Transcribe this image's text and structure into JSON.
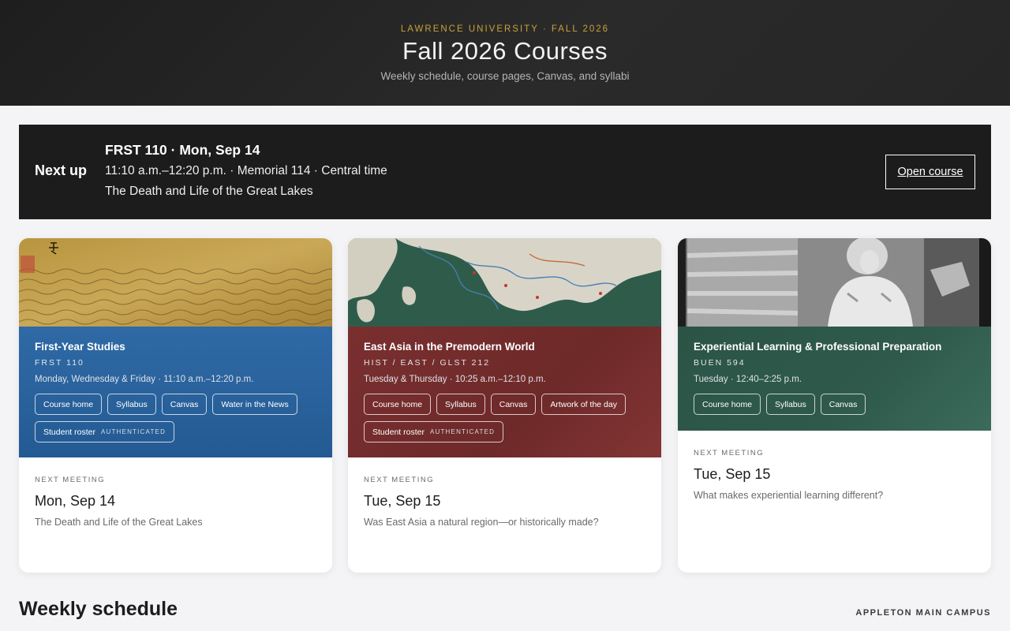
{
  "header": {
    "eyebrow": "LAWRENCE UNIVERSITY · FALL 2026",
    "title": "Fall 2026 Courses",
    "subtitle": "Weekly schedule, course pages, Canvas, and syllabi"
  },
  "next_up": {
    "label": "Next up",
    "line1": "FRST 110 · Mon, Sep 14",
    "line2": "11:10 a.m.–12:20 p.m. · Memorial 114 · Central time",
    "line3": "The Death and Life of the Great Lakes",
    "button": "Open course"
  },
  "cards": [
    {
      "name": "First-Year Studies",
      "code": "FRST 110",
      "time": "Monday, Wednesday & Friday · 11:10 a.m.–12:20 p.m.",
      "image_icon": "waves-scroll-image",
      "links": [
        "Course home",
        "Syllabus",
        "Canvas",
        "Water in the News"
      ],
      "roster": "Student roster",
      "roster_badge": "AUTHENTICATED",
      "meeting_label": "NEXT MEETING",
      "meeting_date": "Mon, Sep 14",
      "meeting_topic": "The Death and Life of the Great Lakes"
    },
    {
      "name": "East Asia in the Premodern World",
      "code": "HIST / EAST / GLST 212",
      "time": "Tuesday & Thursday · 10:25 a.m.–12:10 p.m.",
      "image_icon": "historic-map-image",
      "links": [
        "Course home",
        "Syllabus",
        "Canvas",
        "Artwork of the day"
      ],
      "roster": "Student roster",
      "roster_badge": "AUTHENTICATED",
      "meeting_label": "NEXT MEETING",
      "meeting_date": "Tue, Sep 15",
      "meeting_topic": "Was East Asia a natural region—or historically made?"
    },
    {
      "name": "Experiential Learning & Professional Preparation",
      "code": "BUEN 594",
      "time": "Tuesday · 12:40–2:25 p.m.",
      "image_icon": "workshop-photo-image",
      "links": [
        "Course home",
        "Syllabus",
        "Canvas"
      ],
      "meeting_label": "NEXT MEETING",
      "meeting_date": "Tue, Sep 15",
      "meeting_topic": "What makes experiential learning different?"
    }
  ],
  "weekly": {
    "title": "Weekly schedule",
    "campus": "APPLETON MAIN CAMPUS"
  },
  "colors": {
    "header_bg": "#222222",
    "eyebrow": "#c9a13a",
    "card1_band": "#2a62a0",
    "card2_band": "#762e2e",
    "card3_band": "#2d574a"
  }
}
